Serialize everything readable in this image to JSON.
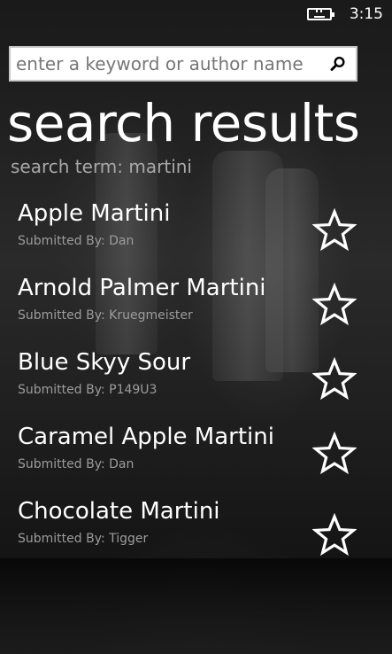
{
  "status_bar": {
    "time": "3:15",
    "battery_icon": "battery-charging-icon"
  },
  "search": {
    "placeholder": "enter a keyword or author name",
    "value": "",
    "button_icon": "search-icon"
  },
  "page": {
    "title": "search results",
    "search_term": "search term: martini"
  },
  "results": [
    {
      "title": "Apple Martini",
      "author": "Submitted By: Dan",
      "favorite_icon": "star-outline-icon"
    },
    {
      "title": "Arnold Palmer Martini",
      "author": "Submitted By: Kruegmeister",
      "favorite_icon": "star-outline-icon"
    },
    {
      "title": "Blue Skyy Sour",
      "author": "Submitted By: P149U3",
      "favorite_icon": "star-outline-icon"
    },
    {
      "title": "Caramel Apple Martini",
      "author": "Submitted By: Dan",
      "favorite_icon": "star-outline-icon"
    },
    {
      "title": "Chocolate  Martini",
      "author": "Submitted By: Tigger",
      "favorite_icon": "star-outline-icon"
    }
  ],
  "colors": {
    "text_primary": "#ffffff",
    "text_secondary": "#9c9c9c",
    "search_term": "#a8a8a8",
    "search_box_bg": "#ffffff"
  }
}
